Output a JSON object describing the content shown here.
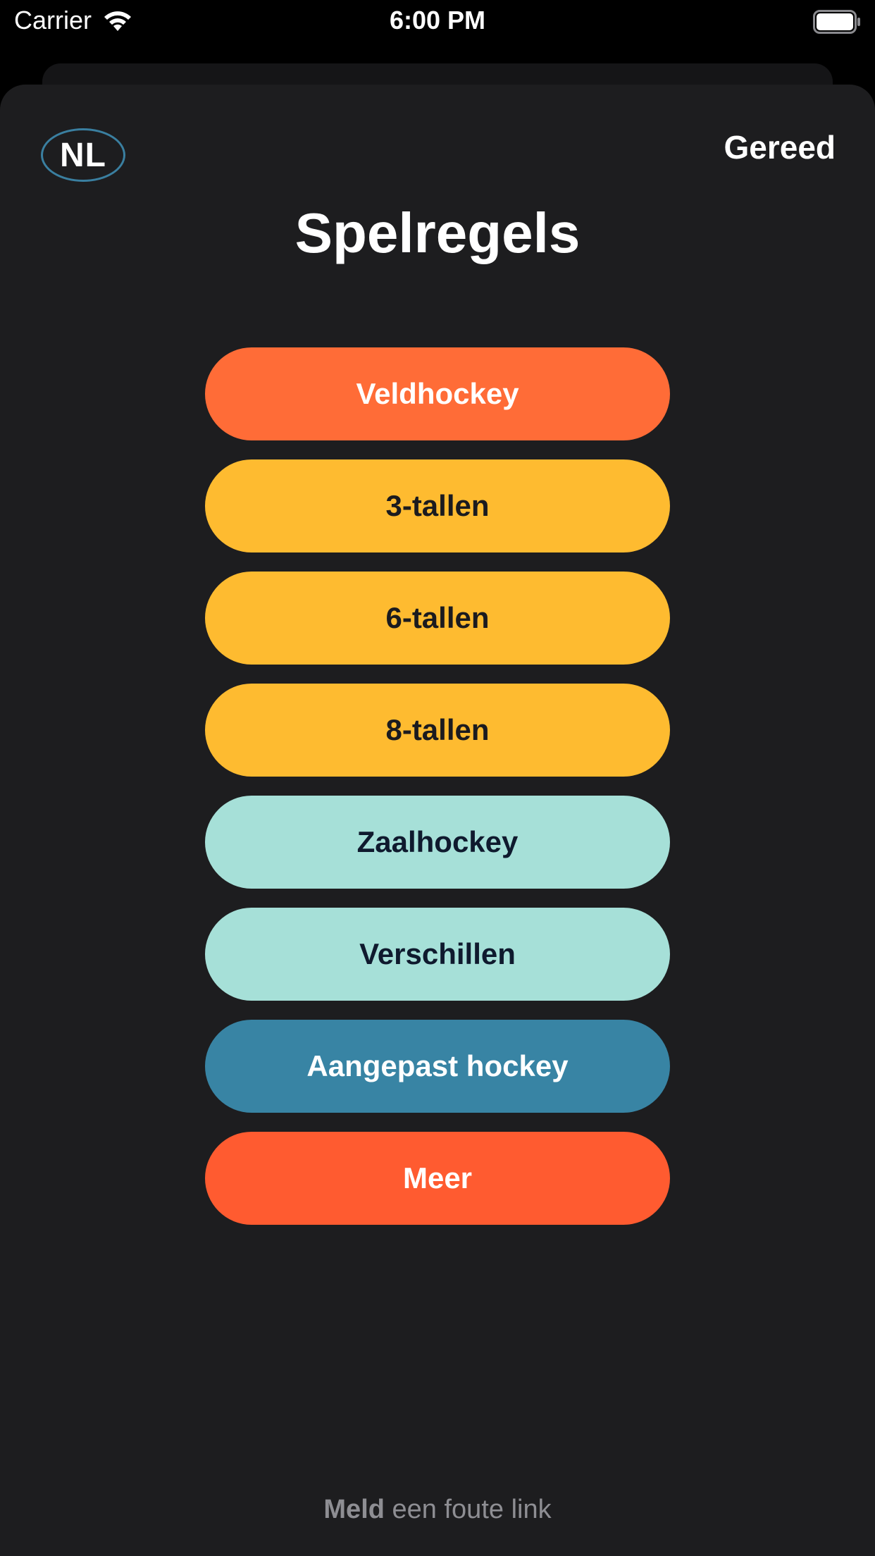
{
  "status_bar": {
    "carrier": "Carrier",
    "time": "6:00 PM"
  },
  "header": {
    "language": "NL",
    "done_label": "Gereed",
    "title": "Spelregels"
  },
  "menu": [
    {
      "label": "Veldhockey",
      "bg": "#ff6c37",
      "fg": "#ffffff"
    },
    {
      "label": "3-tallen",
      "bg": "#febb30",
      "fg": "#1b1b1f"
    },
    {
      "label": "6-tallen",
      "bg": "#febb30",
      "fg": "#1b1b1f"
    },
    {
      "label": "8-tallen",
      "bg": "#febb30",
      "fg": "#1b1b1f"
    },
    {
      "label": "Zaalhockey",
      "bg": "#a6e0d8",
      "fg": "#0f1a2e"
    },
    {
      "label": "Verschillen",
      "bg": "#a6e0d8",
      "fg": "#0f1a2e"
    },
    {
      "label": "Aangepast hockey",
      "bg": "#3884a4",
      "fg": "#ffffff"
    },
    {
      "label": "Meer",
      "bg": "#ff5b30",
      "fg": "#ffffff"
    }
  ],
  "footer": {
    "link_bold": "Meld",
    "link_rest": "een foute link"
  }
}
